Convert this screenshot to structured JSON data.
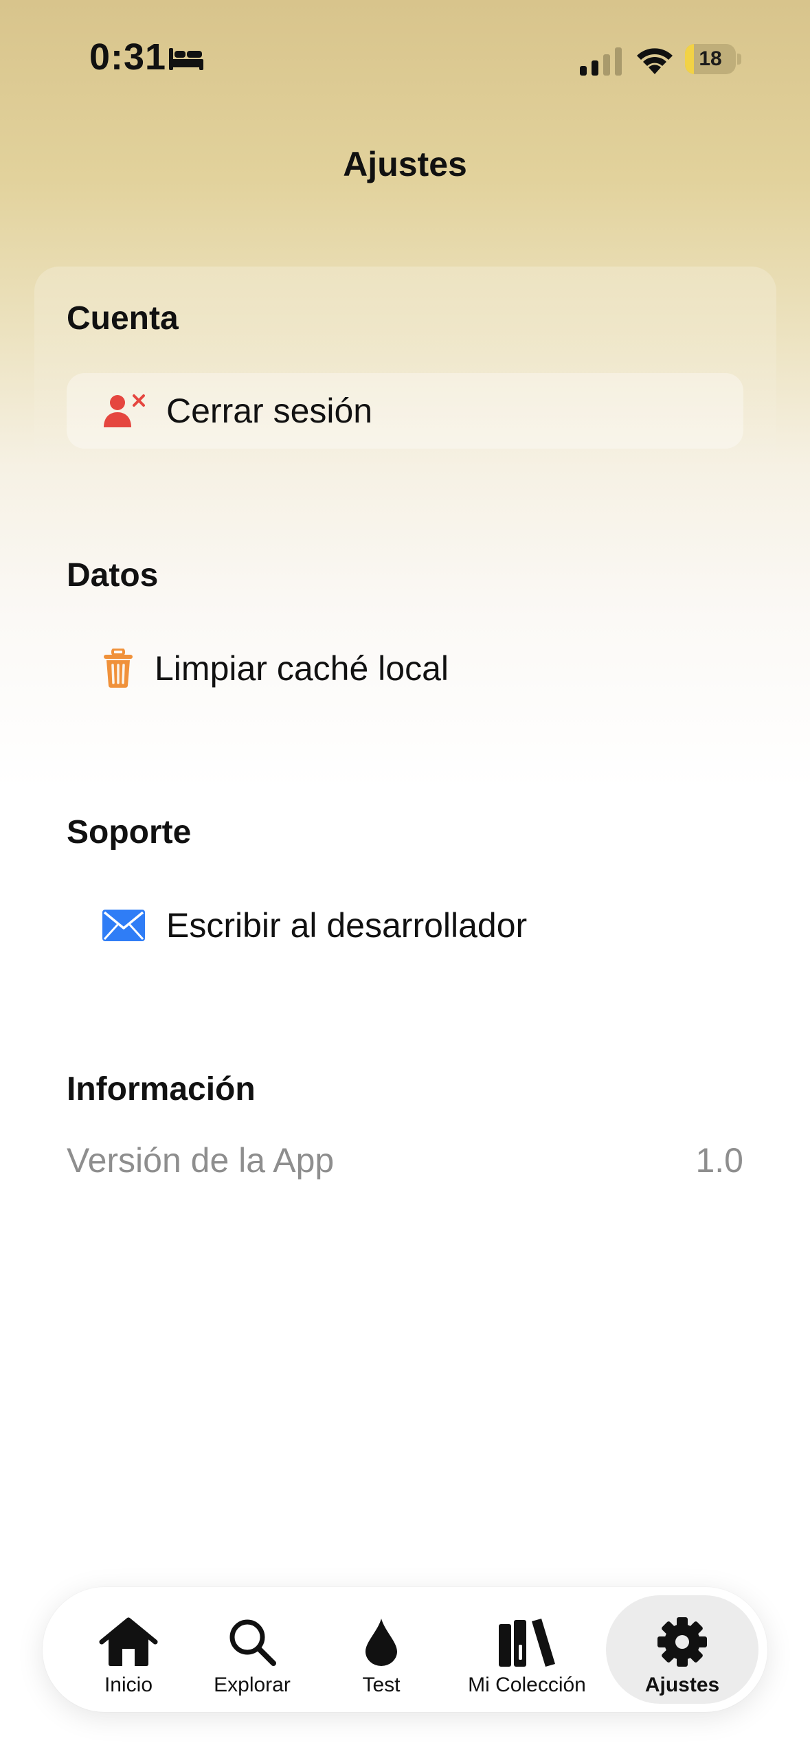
{
  "status_bar": {
    "time": "0:31",
    "battery_level": "18",
    "battery_fraction": 0.18,
    "icons": [
      "bed-icon",
      "signal-icon",
      "wifi-icon",
      "battery-icon"
    ]
  },
  "header": {
    "title": "Ajustes"
  },
  "sections": {
    "account": {
      "title": "Cuenta",
      "logout": {
        "label": "Cerrar sesión",
        "icon": "person-remove-icon",
        "icon_color": "#e5463f"
      }
    },
    "data": {
      "title": "Datos",
      "clear_cache": {
        "label": "Limpiar caché local",
        "icon": "trash-icon",
        "icon_color": "#f0913a"
      }
    },
    "support": {
      "title": "Soporte",
      "contact": {
        "label": "Escribir al desarrollador",
        "icon": "envelope-icon",
        "icon_color": "#2f7df6"
      }
    },
    "info": {
      "title": "Información",
      "version_label": "Versión de la App",
      "version_value": "1.0"
    }
  },
  "tab_bar": {
    "selected": "Ajustes",
    "items": [
      {
        "label": "Inicio",
        "icon": "house-icon"
      },
      {
        "label": "Explorar",
        "icon": "search-icon"
      },
      {
        "label": "Test",
        "icon": "drop-icon"
      },
      {
        "label": "Mi Colección",
        "icon": "books-icon"
      },
      {
        "label": "Ajustes",
        "icon": "gear-icon"
      }
    ]
  }
}
